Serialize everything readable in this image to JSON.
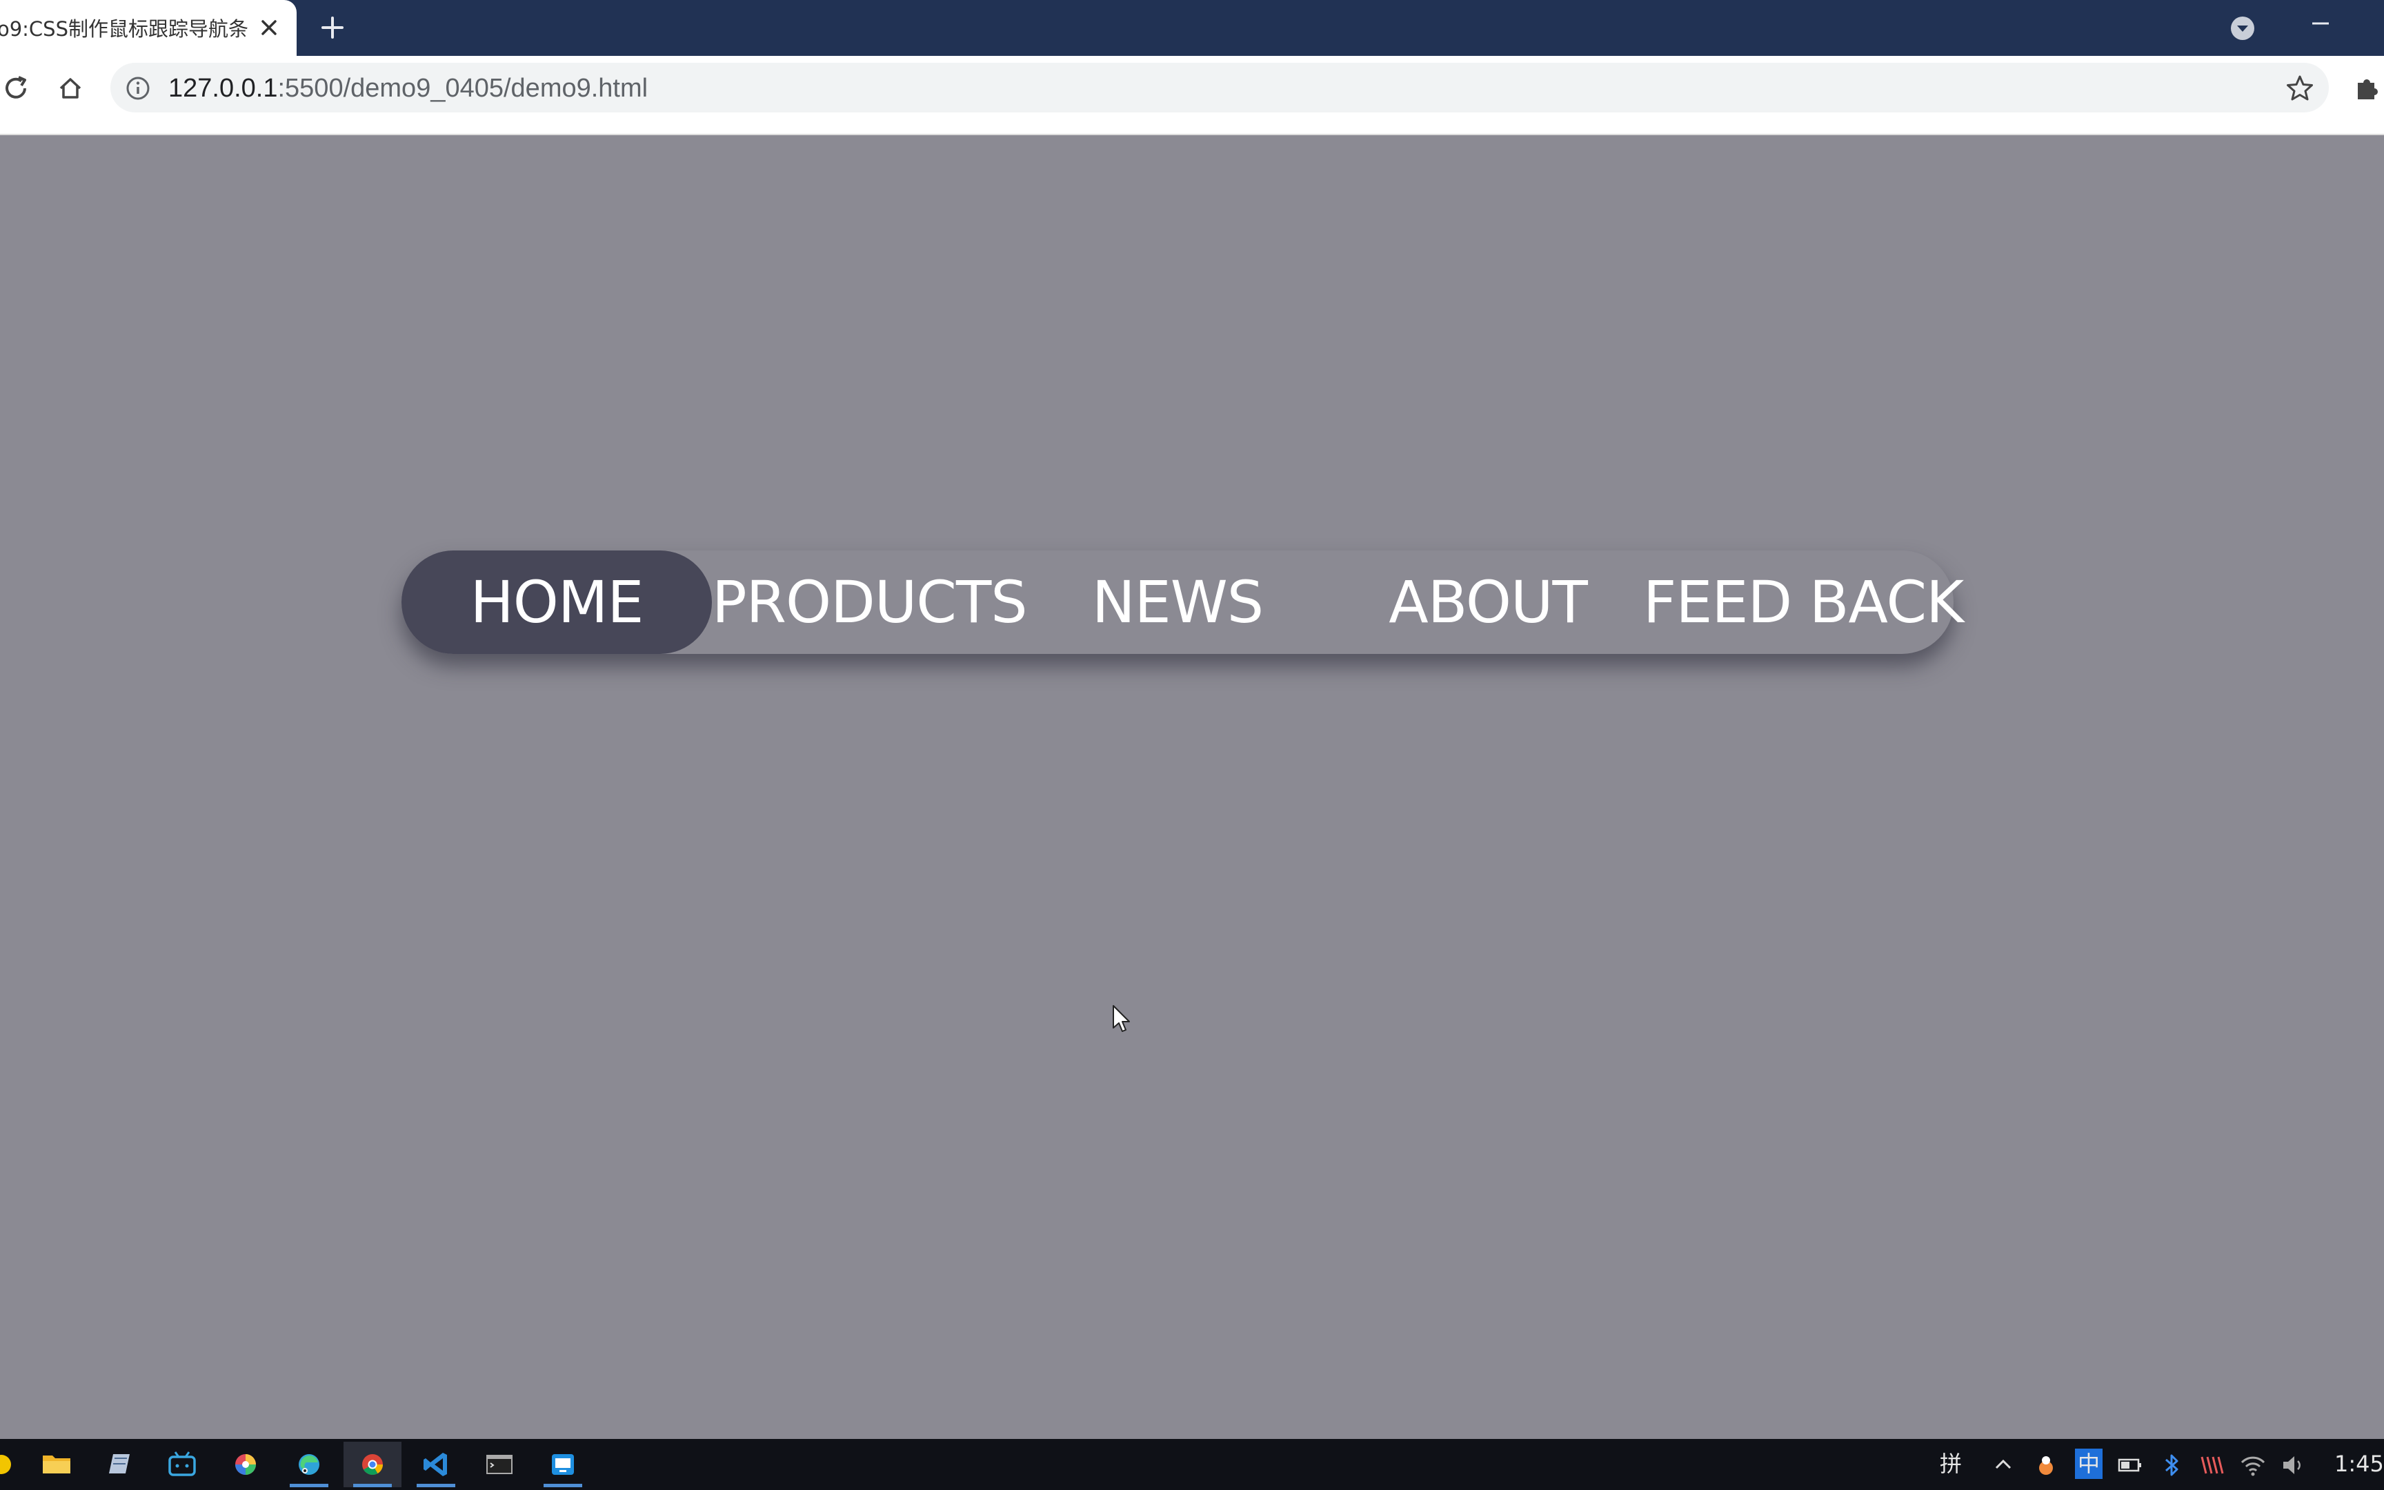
{
  "browser": {
    "tab_title": "o9:CSS制作鼠标跟踪导航条",
    "url_host": "127.0.0.1",
    "url_rest": ":5500/demo9_0405/demo9.html"
  },
  "nav": {
    "items": [
      "HOME",
      "PRODUCTS",
      "NEWS",
      "ABOUT",
      "FEED BACK"
    ],
    "active_index": 0
  },
  "taskbar": {
    "apps": [
      "file-explorer",
      "notes",
      "bilibili",
      "color-app",
      "edge",
      "chrome",
      "vscode",
      "terminal",
      "remote-desktop"
    ],
    "tray": {
      "ime_grid": "拼",
      "ime_lang": "中",
      "time": "1:45"
    }
  },
  "colors": {
    "page_bg": "#8b8a93",
    "nav_highlight": "#474758",
    "tab_strip": "#213254"
  }
}
